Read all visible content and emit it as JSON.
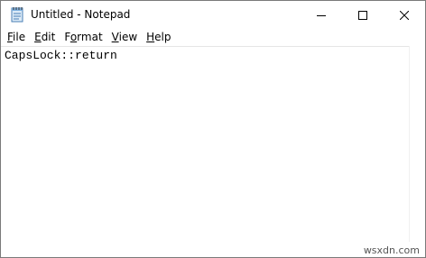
{
  "window": {
    "title": "Untitled - Notepad"
  },
  "menu": {
    "file": {
      "accel": "F",
      "rest": "ile"
    },
    "edit": {
      "accel": "E",
      "rest": "dit"
    },
    "format": {
      "pre": "F",
      "accel": "o",
      "rest": "rmat"
    },
    "view": {
      "accel": "V",
      "rest": "iew"
    },
    "help": {
      "accel": "H",
      "rest": "elp"
    }
  },
  "editor": {
    "content": "CapsLock::return"
  },
  "watermark": "wsxdn.com",
  "colors": {
    "border": "#7a7a7a",
    "text": "#000000",
    "background": "#ffffff"
  },
  "icons": {
    "app": "notepad-icon",
    "minimize": "minimize-icon",
    "maximize": "maximize-icon",
    "close": "close-icon"
  }
}
